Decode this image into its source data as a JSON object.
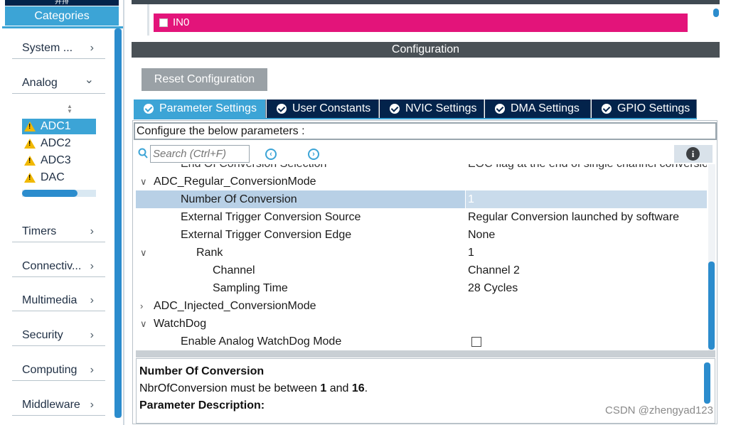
{
  "sidebar": {
    "top_label": "并排",
    "header": "Categories",
    "categories": [
      {
        "label": "System ...",
        "chevron": "›"
      },
      {
        "label": "Analog",
        "chevron": "⌄"
      },
      {
        "label": "Timers",
        "chevron": "›"
      },
      {
        "label": "Connectiv...",
        "chevron": "›"
      },
      {
        "label": "Multimedia",
        "chevron": "›"
      },
      {
        "label": "Security",
        "chevron": "›"
      },
      {
        "label": "Computing",
        "chevron": "›"
      },
      {
        "label": "Middleware",
        "chevron": "›"
      }
    ],
    "analog_items": [
      {
        "label": "ADC1",
        "icon": "warning-icon",
        "selected": true
      },
      {
        "label": "ADC2",
        "icon": "warning-icon",
        "selected": false
      },
      {
        "label": "ADC3",
        "icon": "warning-icon",
        "selected": false
      },
      {
        "label": "DAC",
        "icon": "warning-icon",
        "selected": false
      }
    ],
    "mini_progress": 0.75
  },
  "pinout": {
    "pin_label": "IN0",
    "pin_color": "#e3147a"
  },
  "config": {
    "header": "Configuration",
    "reset_label": "Reset Configuration",
    "tabs": [
      {
        "label": "Parameter Settings",
        "active": true
      },
      {
        "label": "User Constants",
        "active": false
      },
      {
        "label": "NVIC Settings",
        "active": false
      },
      {
        "label": "DMA Settings",
        "active": false
      },
      {
        "label": "GPIO Settings",
        "active": false
      }
    ],
    "configure_label": "Configure the below parameters :",
    "search_placeholder": "Search (Ctrl+F)",
    "prev_glyph": "‹",
    "next_glyph": "›",
    "info_glyph": "i",
    "tree": [
      {
        "name": "End Of Conversion Selection",
        "value": "EOC flag at the end of single channel conversion"
      },
      {
        "name": "ADC_Regular_ConversionMode",
        "value": "",
        "arrow": "∨"
      },
      {
        "name": "Number Of Conversion",
        "value": "1",
        "highlight": true
      },
      {
        "name": "External Trigger Conversion Source",
        "value": "Regular Conversion launched by software"
      },
      {
        "name": "External Trigger Conversion Edge",
        "value": "None"
      },
      {
        "name": "Rank",
        "value": "1",
        "arrow": "∨"
      },
      {
        "name": "Channel",
        "value": "Channel 2"
      },
      {
        "name": "Sampling Time",
        "value": "28 Cycles"
      },
      {
        "name": "ADC_Injected_ConversionMode",
        "value": "",
        "arrow": "›"
      },
      {
        "name": "WatchDog",
        "value": "",
        "arrow": "∨"
      },
      {
        "name": "Enable Analog WatchDog Mode",
        "value": "",
        "checkbox": false
      }
    ],
    "description": {
      "title": "Number Of Conversion",
      "text_prefix": "NbrOfConversion must be between ",
      "min": "1",
      "text_mid": " and ",
      "max": "16",
      "text_suffix": ".",
      "footer": "Parameter Description:"
    }
  },
  "watermark": "CSDN @zhengyad123",
  "colors": {
    "accent": "#3ca4d6",
    "navy": "#03234b",
    "header_gray": "#4a5156",
    "warning": "#f1b800"
  }
}
